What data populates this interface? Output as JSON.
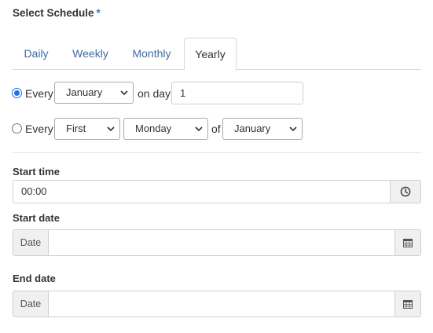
{
  "heading": {
    "title": "Select Schedule",
    "required_marker": "*"
  },
  "tabs": [
    {
      "label": "Daily",
      "active": false
    },
    {
      "label": "Weekly",
      "active": false
    },
    {
      "label": "Monthly",
      "active": false
    },
    {
      "label": "Yearly",
      "active": true
    }
  ],
  "option1": {
    "checked": true,
    "every_label": "Every",
    "month_selected": "January",
    "on_day_label": "on day",
    "day_value": "1"
  },
  "option2": {
    "checked": false,
    "every_label": "Every",
    "ordinal_selected": "First",
    "weekday_selected": "Monday",
    "of_label": "of",
    "month_selected": "January"
  },
  "start_time": {
    "label": "Start time",
    "value": "00:00",
    "icon": "clock-icon"
  },
  "start_date": {
    "label": "Start date",
    "addon": "Date",
    "value": "",
    "icon": "calendar-icon"
  },
  "end_date": {
    "label": "End date",
    "addon": "Date",
    "value": "",
    "icon": "calendar-icon"
  },
  "colors": {
    "link": "#3b6da6",
    "radio_accent": "#1a73e8",
    "required": "#3a78c4"
  }
}
